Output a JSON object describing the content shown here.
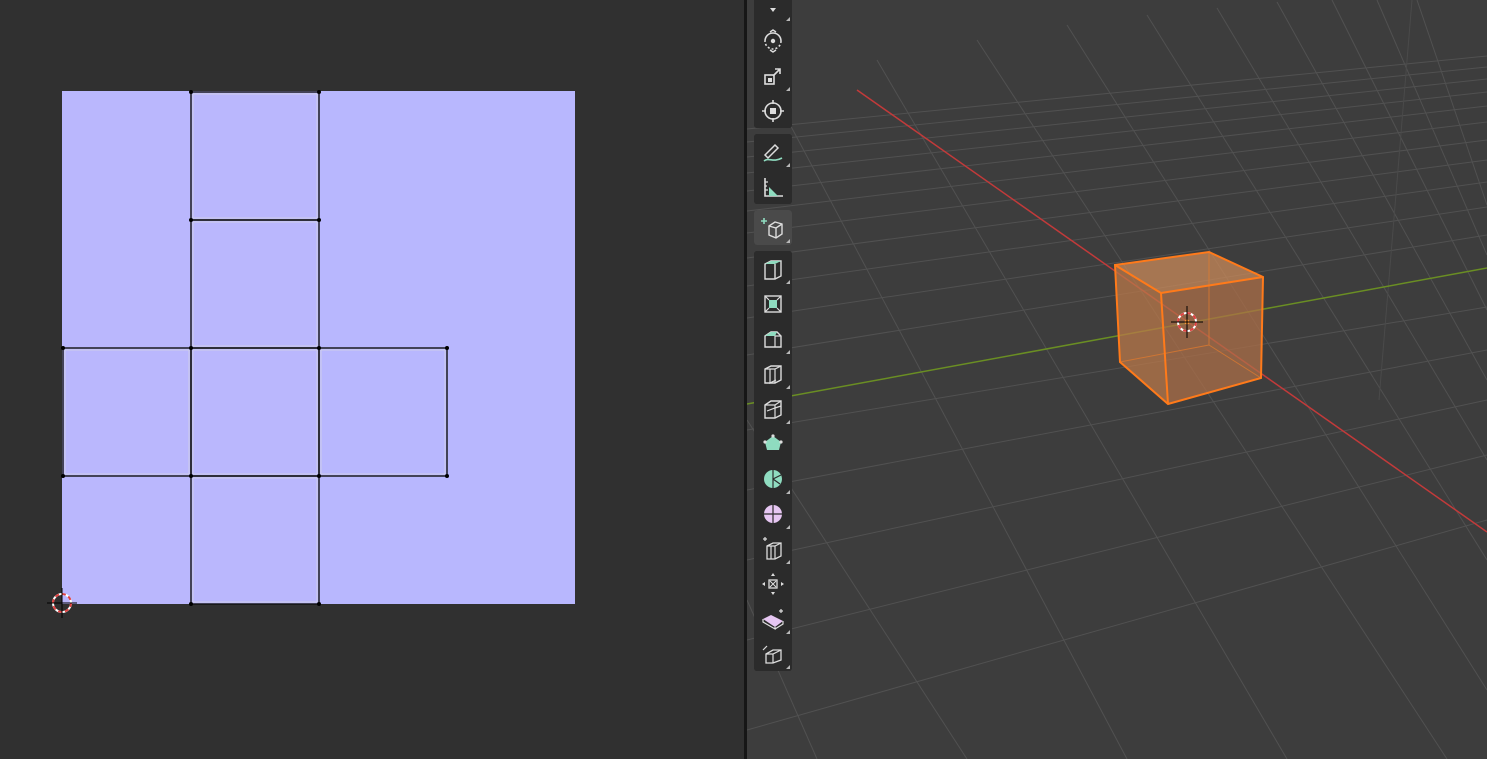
{
  "uv_editor": {
    "image_color": "#b8b7fe",
    "seam_color": "#111111",
    "cursor_colors": [
      "#e04040",
      "#ffffff"
    ]
  },
  "viewport": {
    "background": "#3d3d3d",
    "grid_color": "#555555",
    "x_axis_color": "#c23a3a",
    "y_axis_color": "#6a8e23",
    "selected_object": "Cube",
    "selection_color": "#ff7a1a"
  },
  "toolbar": {
    "groups": [
      [
        {
          "name": "tool-select",
          "icon": "select-box-icon",
          "active": false
        },
        {
          "name": "tool-rotate",
          "icon": "rotate-icon",
          "active": false
        },
        {
          "name": "tool-scale",
          "icon": "scale-icon",
          "active": false
        },
        {
          "name": "tool-transform",
          "icon": "transform-icon",
          "active": false
        }
      ],
      [
        {
          "name": "tool-annotate",
          "icon": "annotate-icon",
          "active": false
        },
        {
          "name": "tool-measure",
          "icon": "measure-icon",
          "active": false
        }
      ],
      [
        {
          "name": "tool-add-cube",
          "icon": "add-cube-icon",
          "active": false
        }
      ],
      [
        {
          "name": "tool-extrude",
          "icon": "extrude-region-icon",
          "active": false
        },
        {
          "name": "tool-inset",
          "icon": "inset-faces-icon",
          "active": false
        },
        {
          "name": "tool-bevel",
          "icon": "bevel-icon",
          "active": false
        },
        {
          "name": "tool-loop-cut",
          "icon": "loop-cut-icon",
          "active": false
        },
        {
          "name": "tool-knife",
          "icon": "knife-icon",
          "active": false
        },
        {
          "name": "tool-poly-build",
          "icon": "poly-build-icon",
          "active": false
        },
        {
          "name": "tool-spin",
          "icon": "spin-icon",
          "active": false
        },
        {
          "name": "tool-smooth",
          "icon": "smooth-icon",
          "active": false
        },
        {
          "name": "tool-edge-slide",
          "icon": "edge-slide-icon",
          "active": false
        },
        {
          "name": "tool-shrink-fatten",
          "icon": "shrink-fatten-icon",
          "active": false
        },
        {
          "name": "tool-shear",
          "icon": "shear-icon",
          "active": false
        },
        {
          "name": "tool-rip-region",
          "icon": "rip-region-icon",
          "active": false
        }
      ]
    ]
  }
}
